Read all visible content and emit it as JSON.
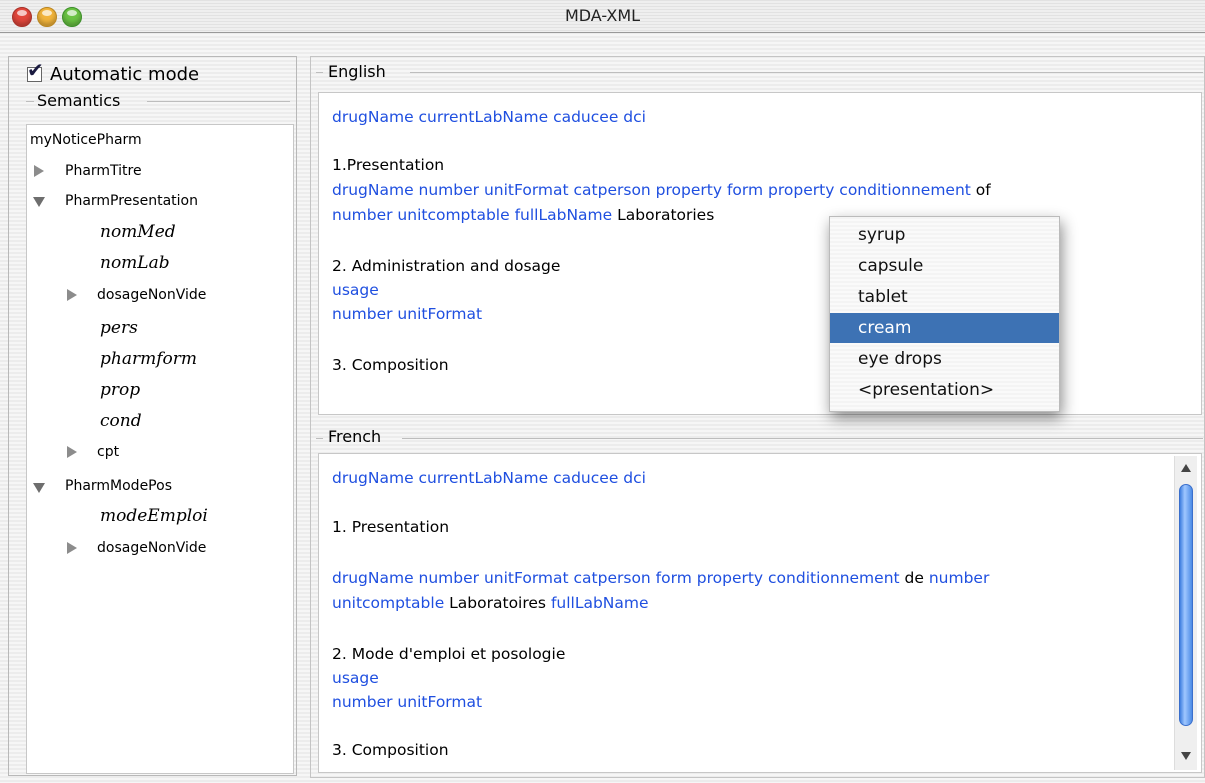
{
  "window": {
    "title": "MDA-XML"
  },
  "left": {
    "automatic_mode_label": "Automatic mode",
    "automatic_mode_checked": true,
    "semantics_label": "Semantics",
    "tree": [
      {
        "label": "myNoticePharm"
      },
      {
        "label": "PharmTitre"
      },
      {
        "label": "PharmPresentation"
      },
      {
        "label": "nomMed"
      },
      {
        "label": "nomLab"
      },
      {
        "label": "dosageNonVide"
      },
      {
        "label": "pers"
      },
      {
        "label": "pharmform"
      },
      {
        "label": "prop"
      },
      {
        "label": "cond"
      },
      {
        "label": "cpt"
      },
      {
        "label": "PharmModePos"
      },
      {
        "label": "modeEmploi"
      },
      {
        "label": "dosageNonVide"
      }
    ]
  },
  "english": {
    "label": "English",
    "l1": "drugName currentLabName caducee dci",
    "l2": "1.Presentation",
    "l3": " drugName number unitFormat catperson property form property conditionnement",
    "l3b": " of",
    "l4a": "number unitcomptable fullLabName",
    "l4b": " Laboratories",
    "l5": "2. Administration and dosage",
    "l6": " usage",
    "l7": " number unitFormat",
    "l8": "3. Composition"
  },
  "french": {
    "label": "French",
    "l1": "drugName currentLabName caducee dci",
    "l2": "1. Presentation",
    "l3a": " drugName number unitFormat catperson form property conditionnement",
    "l3b": " de ",
    "l3c": "number",
    "l4a": "unitcomptable",
    "l4b": " Laboratoires ",
    "l4c": "fullLabName",
    "l5": "2. Mode d'emploi et posologie",
    "l6": " usage",
    "l7": " number unitFormat",
    "l8": "3. Composition"
  },
  "popup": {
    "items": [
      "syrup",
      "capsule",
      "tablet",
      "cream",
      "eye drops",
      "<presentation>"
    ],
    "selected": "cream"
  },
  "colors": {
    "link_blue": "#1f4fe0",
    "selection": "#3d72b4"
  }
}
